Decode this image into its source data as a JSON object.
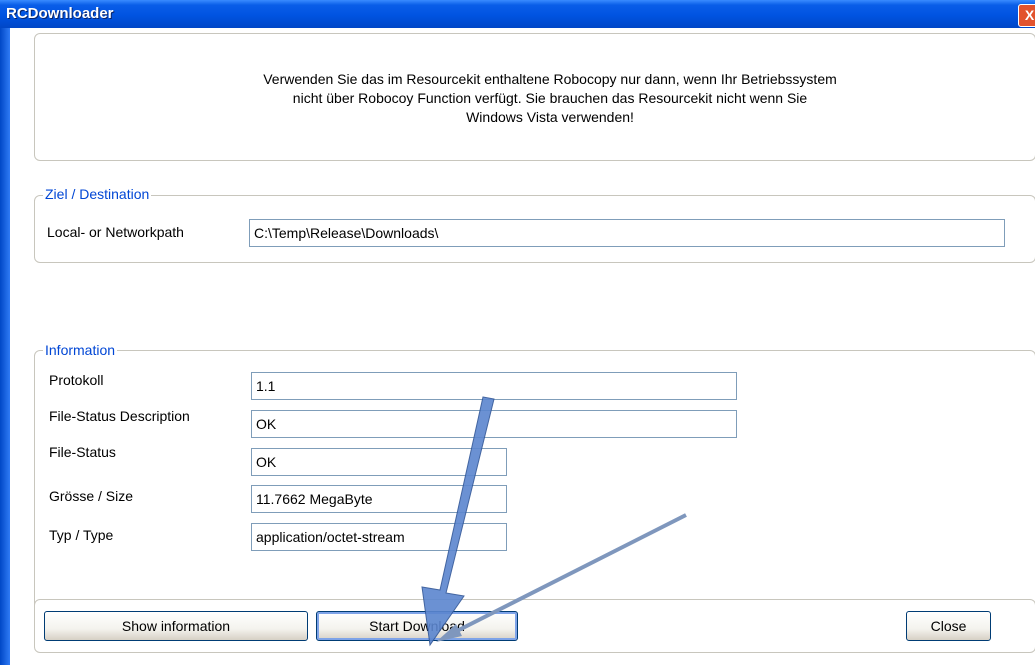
{
  "window": {
    "title": "RCDownloader",
    "close_label": "X"
  },
  "notice": {
    "lines": [
      "Verwenden Sie das im Resourcekit enthaltene Robocopy nur dann, wenn Ihr Betriebssystem",
      "nicht über Robocoy Function verfügt. Sie brauchen das Resourcekit nicht wenn Sie",
      "Windows Vista verwenden!"
    ]
  },
  "destination": {
    "legend": "Ziel / Destination",
    "path_label": "Local- or Networkpath",
    "path_value": "C:\\Temp\\Release\\Downloads\\"
  },
  "information": {
    "legend": "Information",
    "protokoll_label": "Protokoll",
    "protokoll_value": "1.1",
    "file_status_desc_label": "File-Status Description",
    "file_status_desc_value": "OK",
    "file_status_label": "File-Status",
    "file_status_value": "OK",
    "size_label": "Grösse / Size",
    "size_value": "11.7662 MegaByte",
    "type_label": "Typ / Type",
    "type_value": "application/octet-stream"
  },
  "buttons": {
    "show_info": "Show information",
    "start_download": "Start Download",
    "close": "Close"
  },
  "annotation": {
    "arrow_color": "#4a78c2"
  }
}
